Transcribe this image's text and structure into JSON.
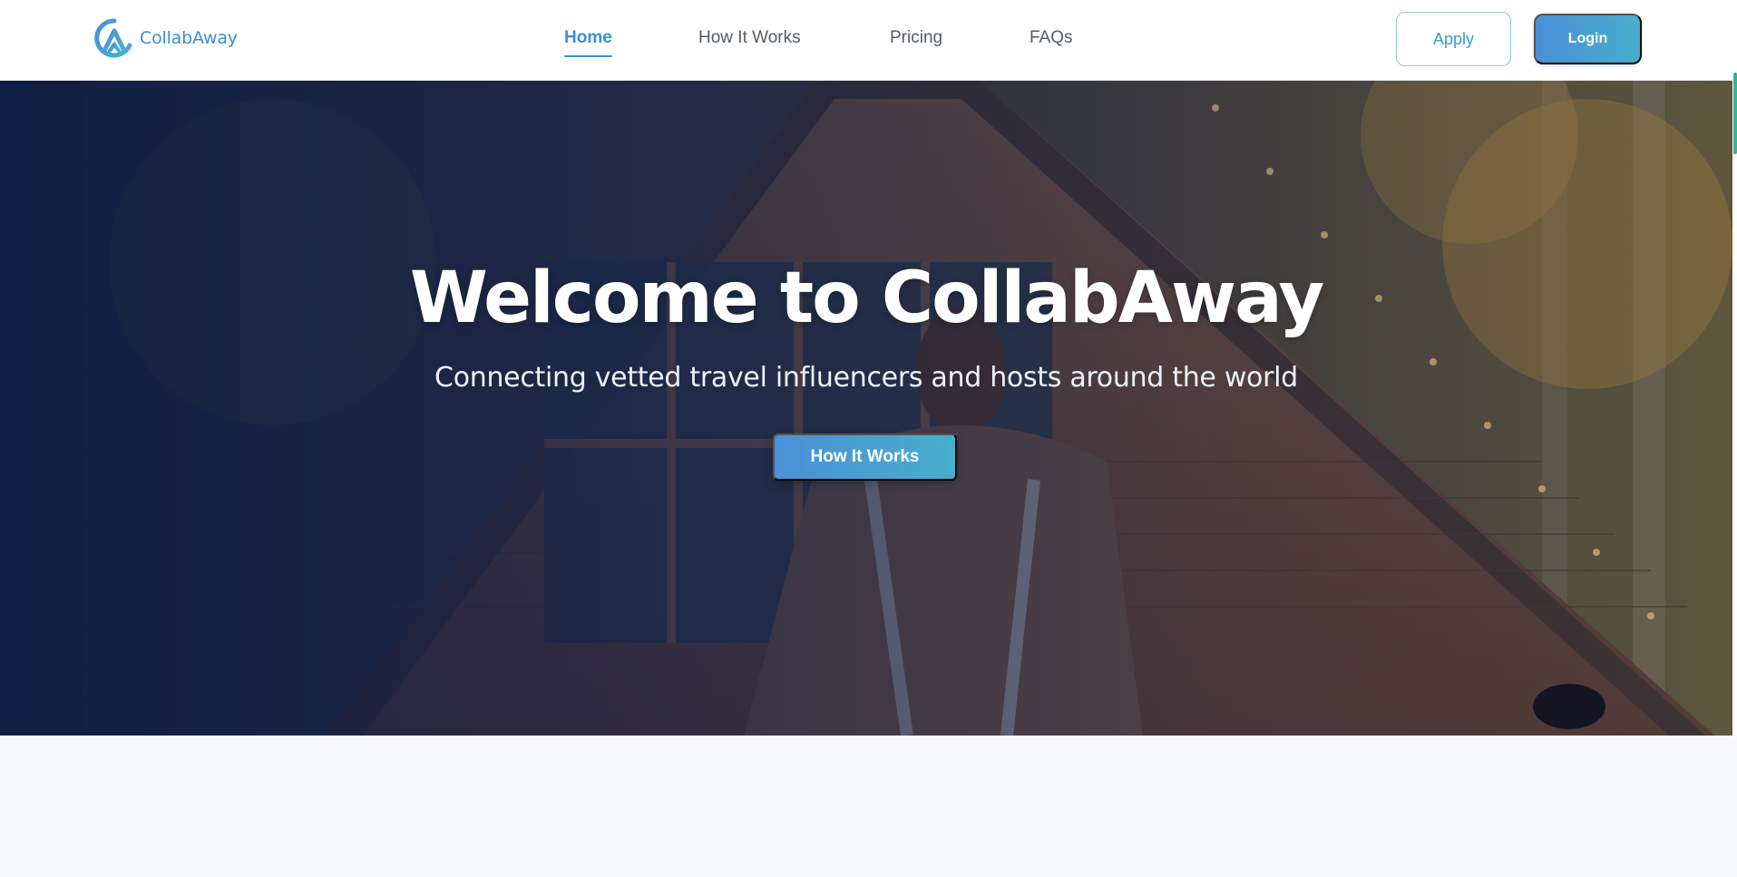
{
  "brand": {
    "name": "CollabAway",
    "logo_icon": "collabaway-logo-icon",
    "accent": "#3b8fd6"
  },
  "nav": {
    "links": [
      {
        "label": "Home",
        "active": true
      },
      {
        "label": "How It Works",
        "active": false
      },
      {
        "label": "Pricing",
        "active": false
      },
      {
        "label": "FAQs",
        "active": false
      }
    ],
    "apply_label": "Apply",
    "login_label": "Login"
  },
  "hero": {
    "title": "Welcome to CollabAway",
    "subtitle": "Connecting vetted travel influencers and hosts around the world",
    "cta_label": "How It Works",
    "background": "a-frame-cabin-photo"
  },
  "colors": {
    "primary_gradient_start": "#4b90d8",
    "primary_gradient_end": "#47aecb",
    "hero_overlay": "#0c1842"
  }
}
